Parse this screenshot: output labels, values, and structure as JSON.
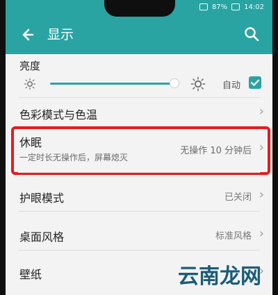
{
  "status": {
    "battery": "87%",
    "time": "14:02"
  },
  "header": {
    "title": "显示"
  },
  "brightness": {
    "label": "亮度",
    "auto_label": "自动"
  },
  "rows": {
    "color_temp": {
      "label": "色彩模式与色温"
    },
    "sleep": {
      "label": "休眠",
      "sub": "一定时长无操作后，屏幕熄灭",
      "value": "无操作 10 分钟后"
    },
    "eye_comfort": {
      "label": "护眼模式",
      "value": "已关闭"
    },
    "desktop_style": {
      "label": "桌面风格",
      "value": "标准风格"
    },
    "wallpaper": {
      "label": "壁纸"
    }
  },
  "watermark": "云南龙网",
  "colors": {
    "header": "#2aa3a3",
    "highlight": "#e51b1b",
    "background": "#f3f3f3"
  }
}
